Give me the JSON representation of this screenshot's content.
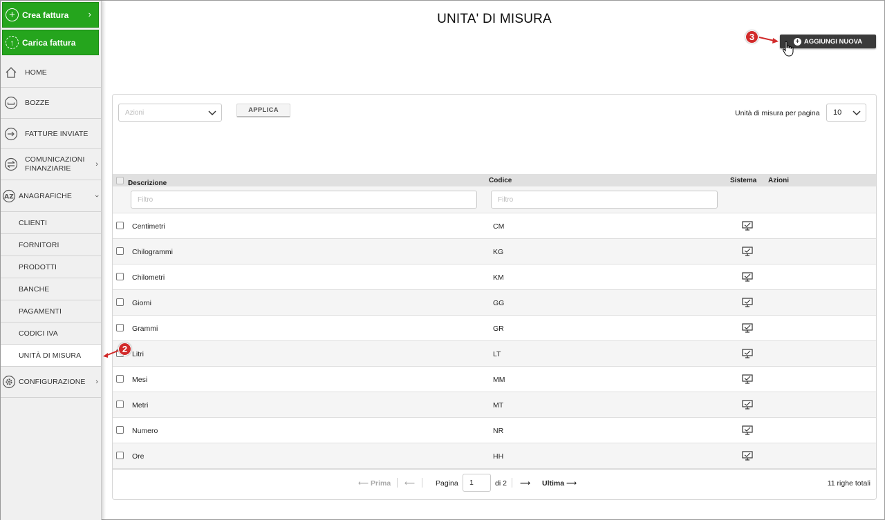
{
  "sidebar": {
    "create_invoice": "Crea fattura",
    "upload_invoice": "Carica fattura",
    "items": [
      {
        "label": "HOME"
      },
      {
        "label": "BOZZE"
      },
      {
        "label": "FATTURE INVIATE"
      },
      {
        "label_line1": "COMUNICAZIONI",
        "label_line2": "FINANZIARIE"
      },
      {
        "label": "ANAGRAFICHE"
      },
      {
        "label": "CLIENTI"
      },
      {
        "label": "FORNITORI"
      },
      {
        "label": "PRODOTTI"
      },
      {
        "label": "BANCHE"
      },
      {
        "label": "PAGAMENTI"
      },
      {
        "label": "CODICI IVA"
      },
      {
        "label": "UNITÀ DI MISURA"
      },
      {
        "label": "CONFIGURAZIONE"
      }
    ],
    "active_item": "UNITÀ DI MISURA"
  },
  "header": {
    "title": "UNITA' DI MISURA",
    "add_button": "AGGIUNGI NUOVA"
  },
  "annotations": {
    "badge_add": "3",
    "badge_sidebar": "2"
  },
  "toolbar": {
    "actions_placeholder": "Azioni",
    "apply_label": "APPLICA",
    "per_page_label": "Unità di misura per pagina",
    "per_page_value": "10"
  },
  "table": {
    "columns": {
      "description": "Descrizione",
      "code": "Codice",
      "system": "Sistema",
      "actions": "Azioni"
    },
    "sort_indicator": "↑",
    "filter_placeholder": "Filtro",
    "rows": [
      {
        "description": "Centimetri",
        "code": "CM"
      },
      {
        "description": "Chilogrammi",
        "code": "KG"
      },
      {
        "description": "Chilometri",
        "code": "KM"
      },
      {
        "description": "Giorni",
        "code": "GG"
      },
      {
        "description": "Grammi",
        "code": "GR"
      },
      {
        "description": "Litri",
        "code": "LT"
      },
      {
        "description": "Mesi",
        "code": "MM"
      },
      {
        "description": "Metri",
        "code": "MT"
      },
      {
        "description": "Numero",
        "code": "NR"
      },
      {
        "description": "Ore",
        "code": "HH"
      }
    ],
    "system_icon": "monitor-check-icon"
  },
  "pager": {
    "first": "Prima",
    "page_label": "Pagina",
    "page_value": "1",
    "of_label": "di 2",
    "last": "Ultima",
    "total": "11 righe totali"
  },
  "colors": {
    "green": "#25a51d",
    "dark_button": "#3a3a3a",
    "badge_red": "#d12a2a"
  }
}
